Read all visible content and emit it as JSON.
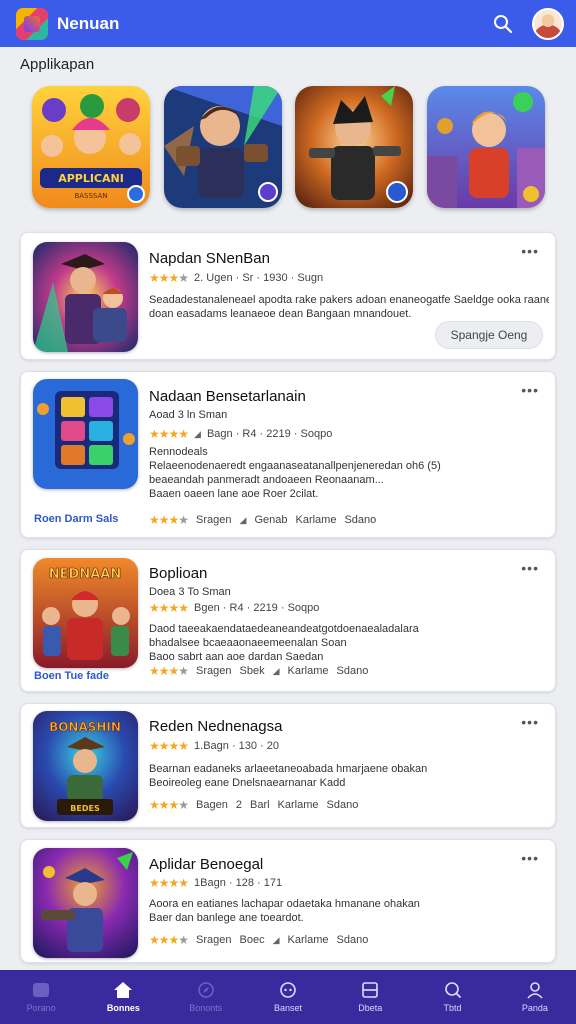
{
  "header": {
    "title": "Nenuan"
  },
  "section": {
    "label": "Applikapan"
  },
  "featured": [
    {
      "name": "feature-tile-1",
      "caption": "APPLICANI",
      "subcaption": "BASSSAN"
    },
    {
      "name": "feature-tile-2"
    },
    {
      "name": "feature-tile-3"
    },
    {
      "name": "feature-tile-4"
    }
  ],
  "cards": [
    {
      "title": "Napdan SNenBan",
      "meta": "2. Ugen · Sr · 1930 · Sugn",
      "desc": [
        "Seadadestanaleneael apodta rake pakers adoan enaneogatfe Saeldge ooka raane -",
        "doan easadams leanaeoe dean Bangaan mnandouet."
      ],
      "action": "Spangje Oeng"
    },
    {
      "title": "Nadaan Bensetarlanain",
      "sub": "Aoad 3 ln Sman",
      "meta": "Bagn · R4 · 2219 · Soqpo",
      "desc": [
        "Rennodeals",
        "Relaeenodenaeredt engaanaseatanallpenjeneredan oh6 (5)",
        "beaeandah panmeradt andoaeen Reonaanam...",
        "Baaen oaeen lane aoe Roer 2cilat."
      ],
      "link": "Roen Darm Sals",
      "bottom": [
        "Sragen",
        "Genab",
        "Karlame",
        "Sdano"
      ]
    },
    {
      "title": "Boplioan",
      "sub": "Doea 3 To Sman",
      "meta": "Bgen · R4 · 2219 · Soqpo",
      "desc": [
        "Daod taeeakaendataedeaneandeatgotdoenaealadalara",
        "bhadalsee bcaeaaonaeemeenalan Soan",
        "Baoo sabrt aan aoe dardan Saedan"
      ],
      "link": "Boen Tue fade",
      "bottom": [
        "Sragen",
        "Sbek",
        "Karlame",
        "Sdano"
      ]
    },
    {
      "title": "Reden Nednenagsa",
      "meta": "1.Bagn · 130 · 20",
      "desc": [
        "Bearnan eadaneks arlaeetaneoabada hmarjaene obakan",
        "Beoireoleg eane Dnelsnaearnanar Kadd"
      ],
      "bottom": [
        "Bagen",
        "2",
        "Barl",
        "Karlame",
        "Sdano"
      ]
    },
    {
      "title": "Aplidar Benoegal",
      "meta": "1Bagn · 128 · 171",
      "desc": [
        "Aoora en eatianes lachapar odaetaka hmanane ohakan",
        "Baer dan banlege ane toeardot."
      ],
      "bottom": [
        "Sragen",
        "Boec",
        "Karlame",
        "Sdano"
      ]
    }
  ],
  "tile_art": {
    "thumb4_text": "BONASHIN",
    "thumb4_sub": "BEDES",
    "thumb3_text": "NEDNAAN"
  },
  "nav": [
    {
      "label": "Porano"
    },
    {
      "label": "Bonnes"
    },
    {
      "label": "Bononts"
    },
    {
      "label": "Banset"
    },
    {
      "label": "Dbeta"
    },
    {
      "label": "Tbtd"
    },
    {
      "label": "Panda"
    }
  ]
}
